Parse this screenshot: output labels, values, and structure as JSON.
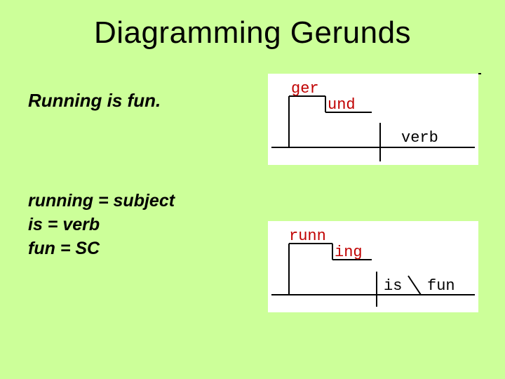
{
  "title": "Diagramming Gerunds",
  "sentence": "Running is fun.",
  "analysis": {
    "line1": "running  = subject",
    "line2": "is = verb",
    "line3": "fun = SC"
  },
  "diagram1": {
    "word_upper": "ger",
    "word_lower": "und",
    "right_word": "verb"
  },
  "diagram2": {
    "word_upper": "runn",
    "word_lower": "ing",
    "mid_word": "is",
    "right_word": "fun"
  }
}
